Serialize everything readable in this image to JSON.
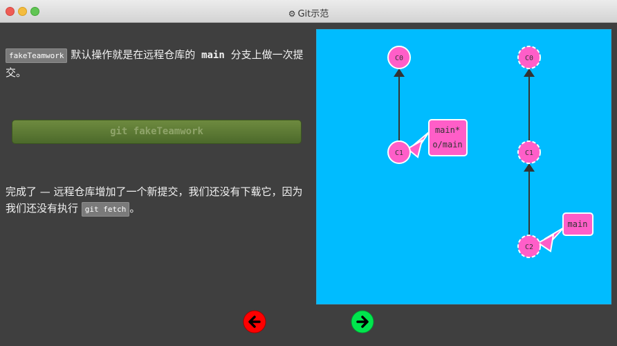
{
  "window": {
    "title": "Git示范",
    "gear_icon": "⚙"
  },
  "lesson": {
    "para1_code": "fakeTeamwork",
    "para1_text_a": "默认操作就是在远程仓库的",
    "para1_bold": "main",
    "para1_text_b": "分支上做一次提交。",
    "command_button": "git fakeTeamwork",
    "para2_text_a": "完成了 — 远程仓库增加了一个新提交，我们还没有下载它，因为我们还没有执行",
    "para2_code": "git fetch",
    "para2_text_b": "。"
  },
  "graph": {
    "local_commits": [
      "C0",
      "C1"
    ],
    "local_branch_label_1": "main*",
    "local_branch_label_2": "o/main",
    "remote_commits": [
      "C0",
      "C1",
      "C2"
    ],
    "remote_branch_label": "main",
    "colors": {
      "canvas": "#00bcff",
      "commit_fill": "#ff5ec8",
      "branch_fill": "#ff5ec8",
      "edge": "#333333"
    }
  },
  "nav": {
    "back_icon": "arrow-left-icon",
    "forward_icon": "arrow-right-icon",
    "back_color": "#ff0000",
    "forward_color": "#00e64d"
  }
}
